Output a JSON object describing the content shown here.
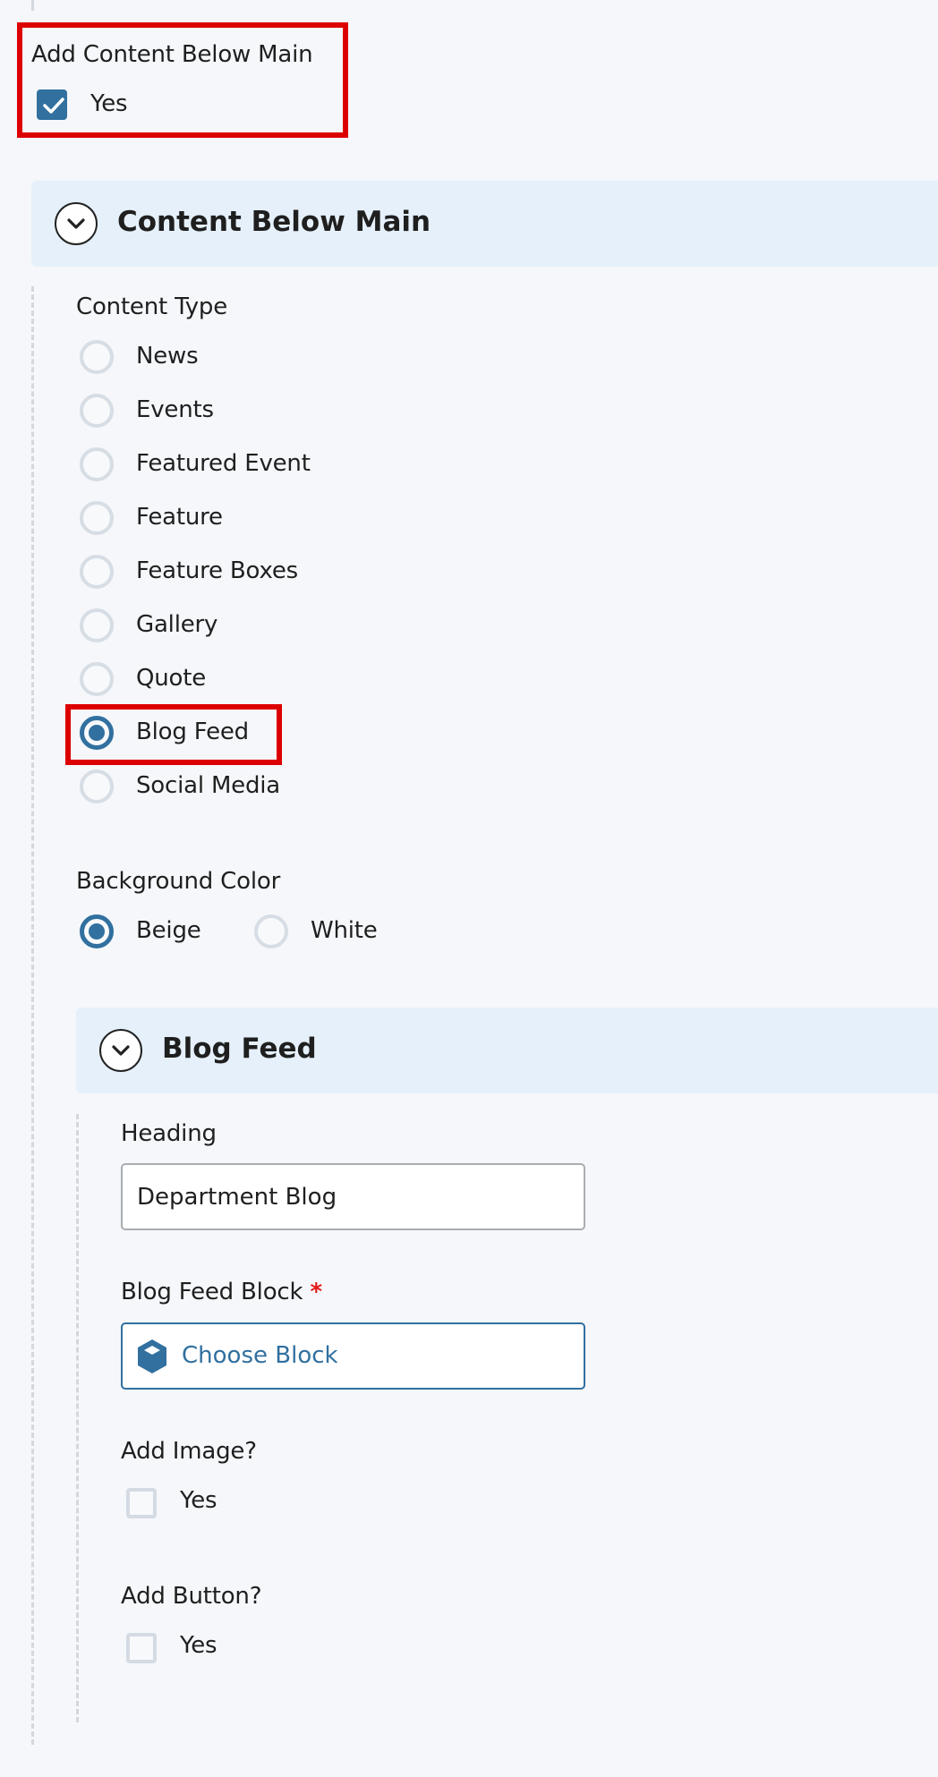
{
  "add_content_below_main": {
    "label": "Add Content Below Main",
    "checkbox_label": "Yes",
    "checked": true
  },
  "content_below_main_section": {
    "title": "Content Below Main",
    "expanded": true,
    "content_type": {
      "label": "Content Type",
      "options": [
        {
          "label": "News",
          "selected": false
        },
        {
          "label": "Events",
          "selected": false
        },
        {
          "label": "Featured Event",
          "selected": false
        },
        {
          "label": "Feature",
          "selected": false
        },
        {
          "label": "Feature Boxes",
          "selected": false
        },
        {
          "label": "Gallery",
          "selected": false
        },
        {
          "label": "Quote",
          "selected": false
        },
        {
          "label": "Blog Feed",
          "selected": true
        },
        {
          "label": "Social Media",
          "selected": false
        }
      ]
    },
    "background_color": {
      "label": "Background Color",
      "options": [
        {
          "label": "Beige",
          "selected": true
        },
        {
          "label": "White",
          "selected": false
        }
      ]
    }
  },
  "blog_feed_section": {
    "title": "Blog Feed",
    "expanded": true,
    "heading": {
      "label": "Heading",
      "value": "Department Blog"
    },
    "blog_feed_block": {
      "label": "Blog Feed Block",
      "required_marker": "*",
      "button_label": "Choose Block",
      "icon": "cube-icon"
    },
    "add_image": {
      "label": "Add Image?",
      "checkbox_label": "Yes",
      "checked": false
    },
    "add_button": {
      "label": "Add Button?",
      "checkbox_label": "Yes",
      "checked": false
    }
  },
  "colors": {
    "accent": "#31709f",
    "highlight": "#dd0000",
    "section_header_bg": "#e5f0fa",
    "required": "#e41b1b",
    "page_bg": "#f5f7fa"
  }
}
